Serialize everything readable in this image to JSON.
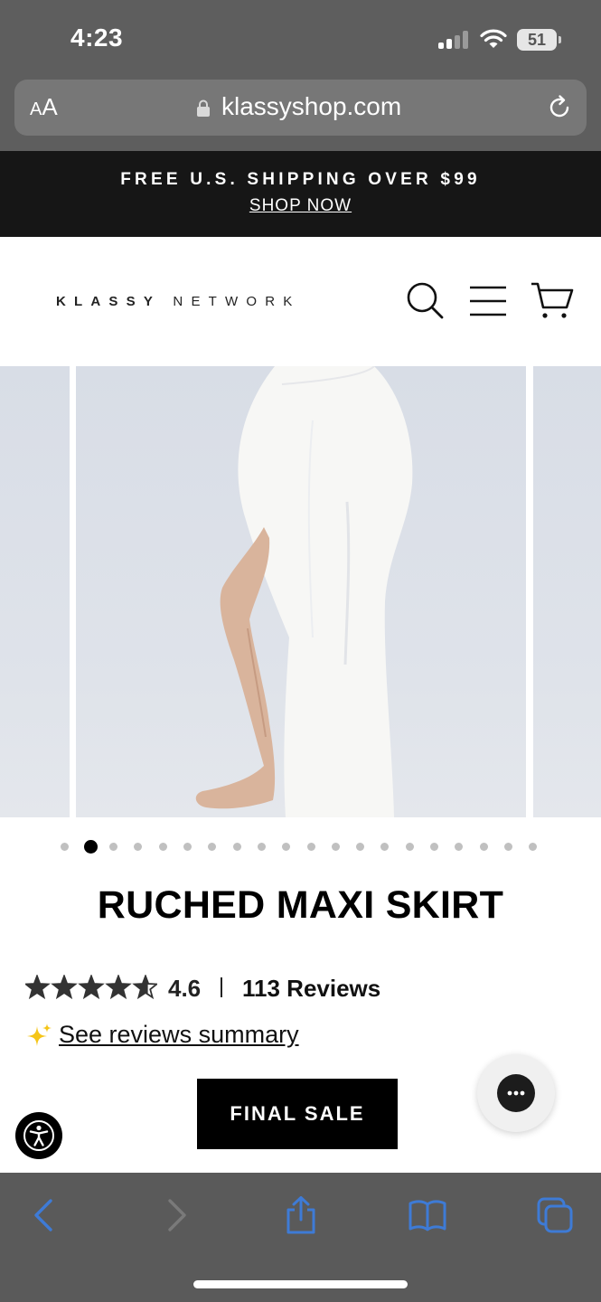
{
  "status_bar": {
    "time": "4:23",
    "battery": "51"
  },
  "browser": {
    "aa_label_large": "A",
    "aa_label_small": "A",
    "url": "klassyshop.com"
  },
  "announcement": {
    "text": "FREE U.S. SHIPPING OVER $99",
    "link": "SHOP NOW"
  },
  "header": {
    "logo_bold": "KLASSY",
    "logo_light": "NETWORK"
  },
  "gallery": {
    "slide_count": 20,
    "active_index": 1
  },
  "product": {
    "title": "RUCHED MAXI SKIRT",
    "rating": "4.6",
    "rating_fraction": 0.92,
    "reviews": "113 Reviews",
    "summary_link": "See reviews summary",
    "sale_badge": "FINAL SALE"
  },
  "colors": {
    "announcement_bg": "#161616",
    "browser_chrome": "#5e5e5e",
    "toolbar_icon_active": "#3e7bd6",
    "sparkle": "#f5c518"
  },
  "icons": {
    "header": [
      "search-icon",
      "menu-icon",
      "cart-icon"
    ],
    "toolbar": [
      "back-icon",
      "forward-icon",
      "share-icon",
      "bookmarks-icon",
      "tabs-icon"
    ]
  }
}
